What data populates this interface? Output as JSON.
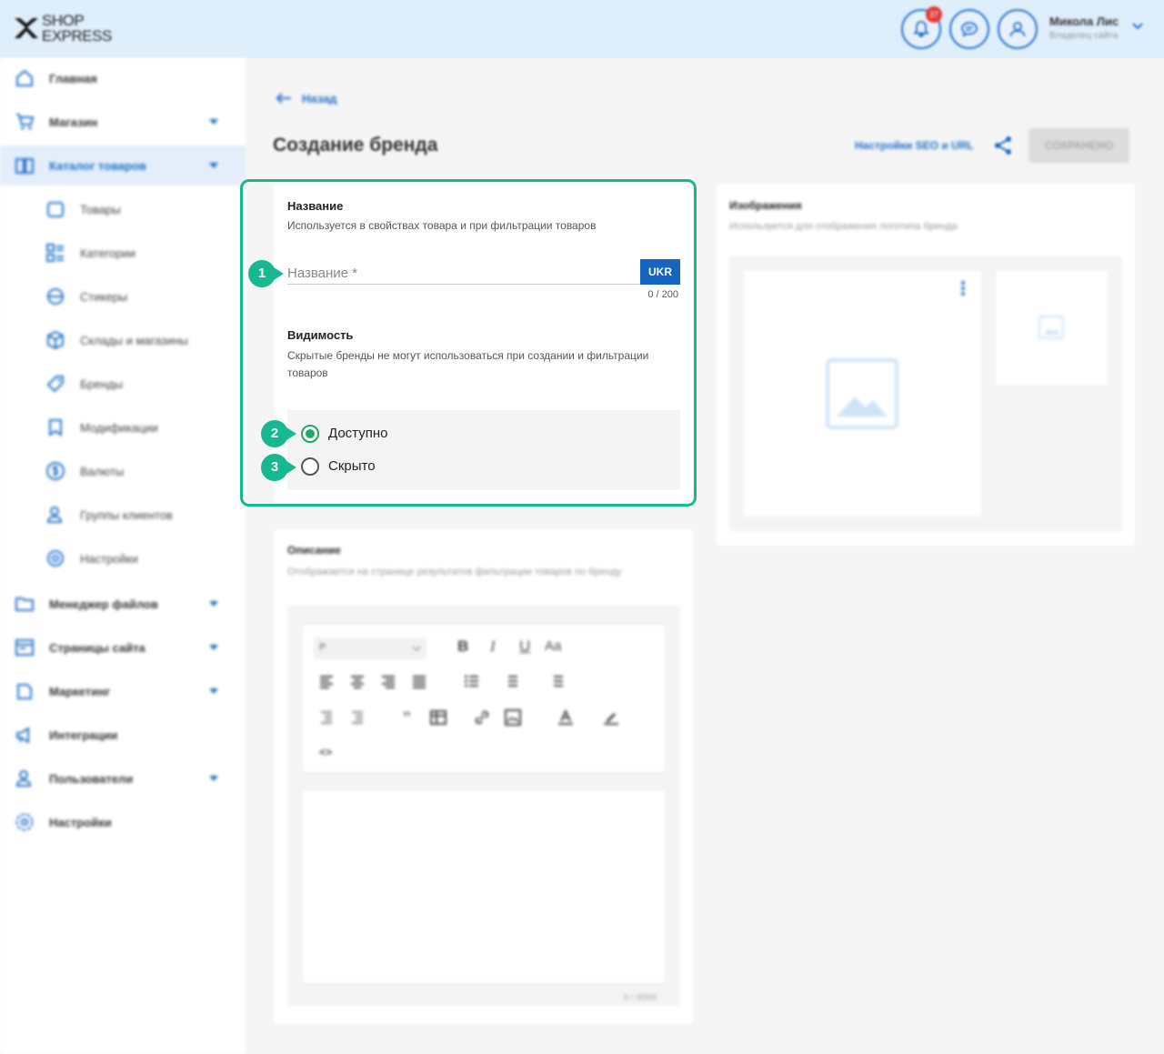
{
  "header": {
    "logo_line1": "SHOP",
    "logo_line2": "EXPRESS",
    "notification_count": "37",
    "user_name": "Микола Лис",
    "user_role": "Владелец сайта"
  },
  "sidebar": {
    "items": [
      {
        "label": "Главная",
        "icon": "home-icon"
      },
      {
        "label": "Магазин",
        "icon": "cart-icon"
      },
      {
        "label": "Каталог товаров",
        "icon": "catalog-icon"
      },
      {
        "label": "Менеджер файлов",
        "icon": "folder-icon"
      },
      {
        "label": "Страницы сайта",
        "icon": "pages-icon"
      },
      {
        "label": "Маркетинг",
        "icon": "marketing-icon"
      },
      {
        "label": "Интеграции",
        "icon": "megaphone-icon"
      },
      {
        "label": "Пользователи",
        "icon": "users-icon"
      },
      {
        "label": "Настройки",
        "icon": "gear-icon"
      }
    ],
    "subitems": [
      {
        "label": "Товары",
        "icon": "product-icon"
      },
      {
        "label": "Категории",
        "icon": "categories-icon"
      },
      {
        "label": "Стикеры",
        "icon": "sticker-icon"
      },
      {
        "label": "Склады и магазины",
        "icon": "warehouse-icon"
      },
      {
        "label": "Бренды",
        "icon": "brand-tag-icon"
      },
      {
        "label": "Модификации",
        "icon": "modification-icon"
      },
      {
        "label": "Валюты",
        "icon": "currency-icon"
      },
      {
        "label": "Группы клиентов",
        "icon": "client-group-icon"
      },
      {
        "label": "Настройки",
        "icon": "settings-icon"
      }
    ]
  },
  "page": {
    "back_label": "Назад",
    "title": "Создание бренда",
    "seo_link": "Настройки SEO и URL",
    "save_label": "СОХРАНЕНО"
  },
  "name_card": {
    "title": "Название",
    "subtitle": "Используется в свойствах товара и при фильтрации товаров",
    "placeholder": "Название *",
    "lang": "UKR",
    "counter": "0 / 200",
    "visibility_title": "Видимость",
    "visibility_subtitle": "Скрытые бренды не могут использоваться при создании и фильтрации товаров",
    "options": [
      {
        "label": "Доступно",
        "selected": true
      },
      {
        "label": "Скрыто",
        "selected": false
      }
    ]
  },
  "steps": [
    "1",
    "2",
    "3"
  ],
  "description_card": {
    "title": "Описание",
    "subtitle": "Отображается на странице результатов фильтрации товаров по бренду",
    "format_value": "P",
    "counter": "0 / 8000"
  },
  "images_card": {
    "title": "Изображения",
    "subtitle": "Используется для отображения логотипа бренда"
  },
  "colors": {
    "accent": "#1e6fc8",
    "highlight": "#17b890",
    "radio_selected": "#1fa86b"
  }
}
